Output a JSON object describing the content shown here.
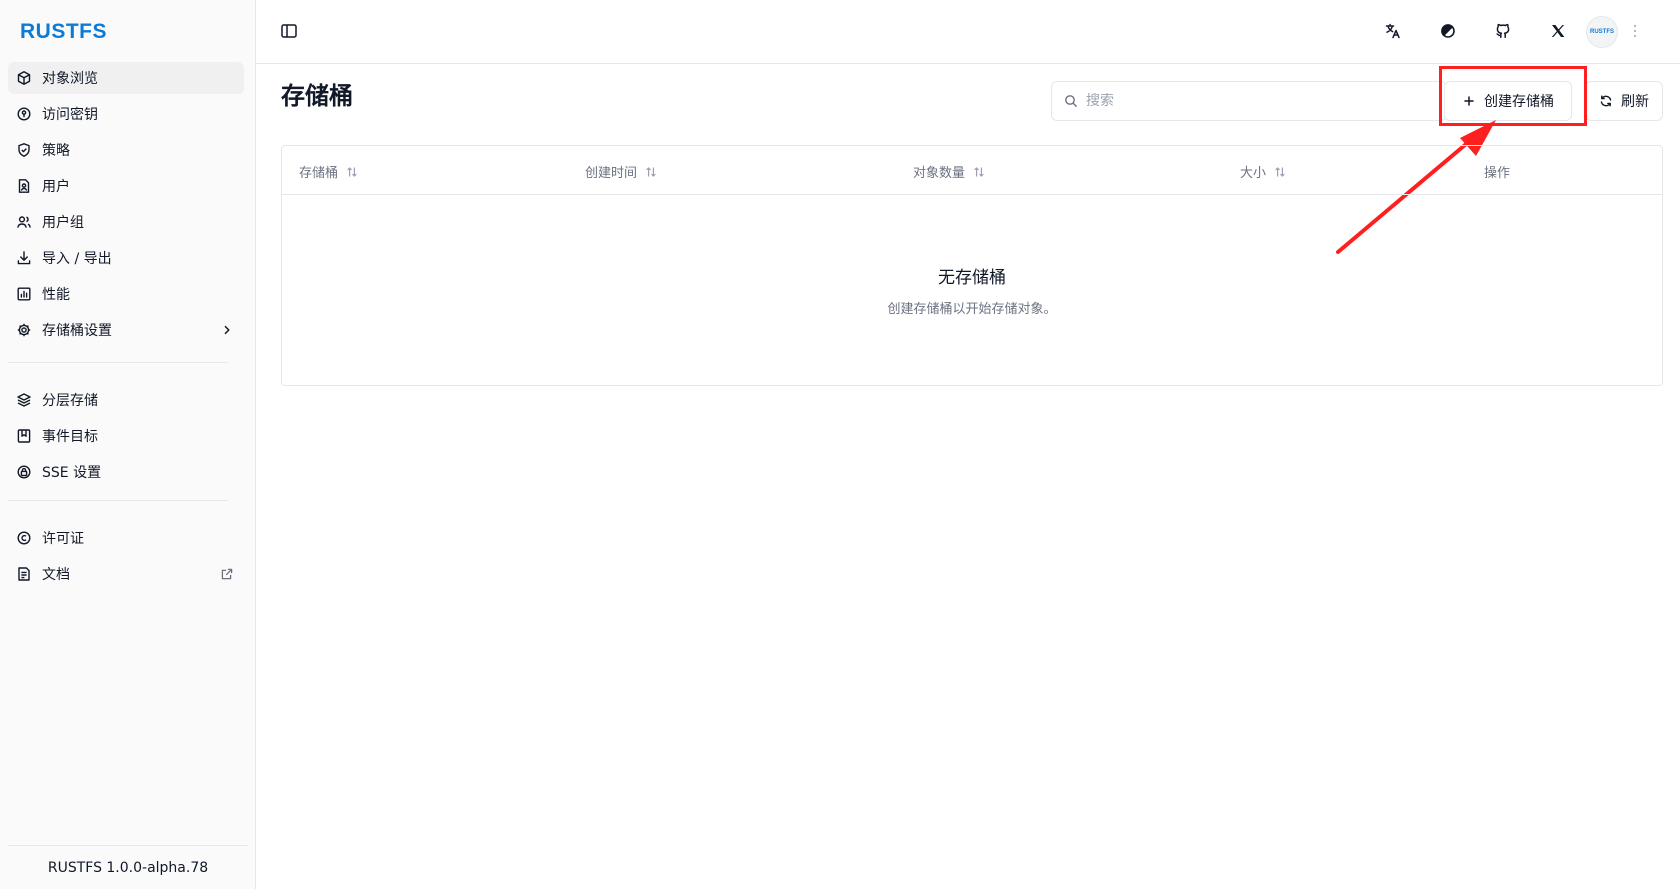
{
  "sidebar": {
    "logo": "RUSTFS",
    "groups": [
      [
        {
          "label": "对象浏览",
          "icon": "cube-icon",
          "active": true
        },
        {
          "label": "访问密钥",
          "icon": "key-icon"
        },
        {
          "label": "策略",
          "icon": "shield-icon"
        },
        {
          "label": "用户",
          "icon": "user-file-icon"
        },
        {
          "label": "用户组",
          "icon": "users-icon"
        },
        {
          "label": "导入 / 导出",
          "icon": "download-icon"
        },
        {
          "label": "性能",
          "icon": "chart-icon"
        },
        {
          "label": "存储桶设置",
          "icon": "gear-icon",
          "trailing": "chevron-right-icon"
        }
      ],
      [
        {
          "label": "分层存储",
          "icon": "layers-icon"
        },
        {
          "label": "事件目标",
          "icon": "bookmark-icon"
        },
        {
          "label": "SSE 设置",
          "icon": "lock-icon"
        }
      ],
      [
        {
          "label": "许可证",
          "icon": "copyright-icon"
        },
        {
          "label": "文档",
          "icon": "doc-icon",
          "trailing": "external-link-icon"
        }
      ]
    ],
    "footer": "RUSTFS 1.0.0-alpha.78"
  },
  "header": {
    "icons": [
      "translate-icon",
      "theme-icon",
      "github-icon",
      "x-logo-icon"
    ],
    "avatar": "RUSTFS"
  },
  "main": {
    "title": "存储桶",
    "search_placeholder": "搜索",
    "create_label": "创建存储桶",
    "refresh_label": "刷新",
    "columns": [
      "存储桶",
      "创建时间",
      "对象数量",
      "大小",
      "操作"
    ],
    "empty_title": "无存储桶",
    "empty_desc": "创建存储桶以开始存储对象。"
  },
  "colors": {
    "brand": "#0b7bd6",
    "highlight": "#ff1f1f"
  }
}
